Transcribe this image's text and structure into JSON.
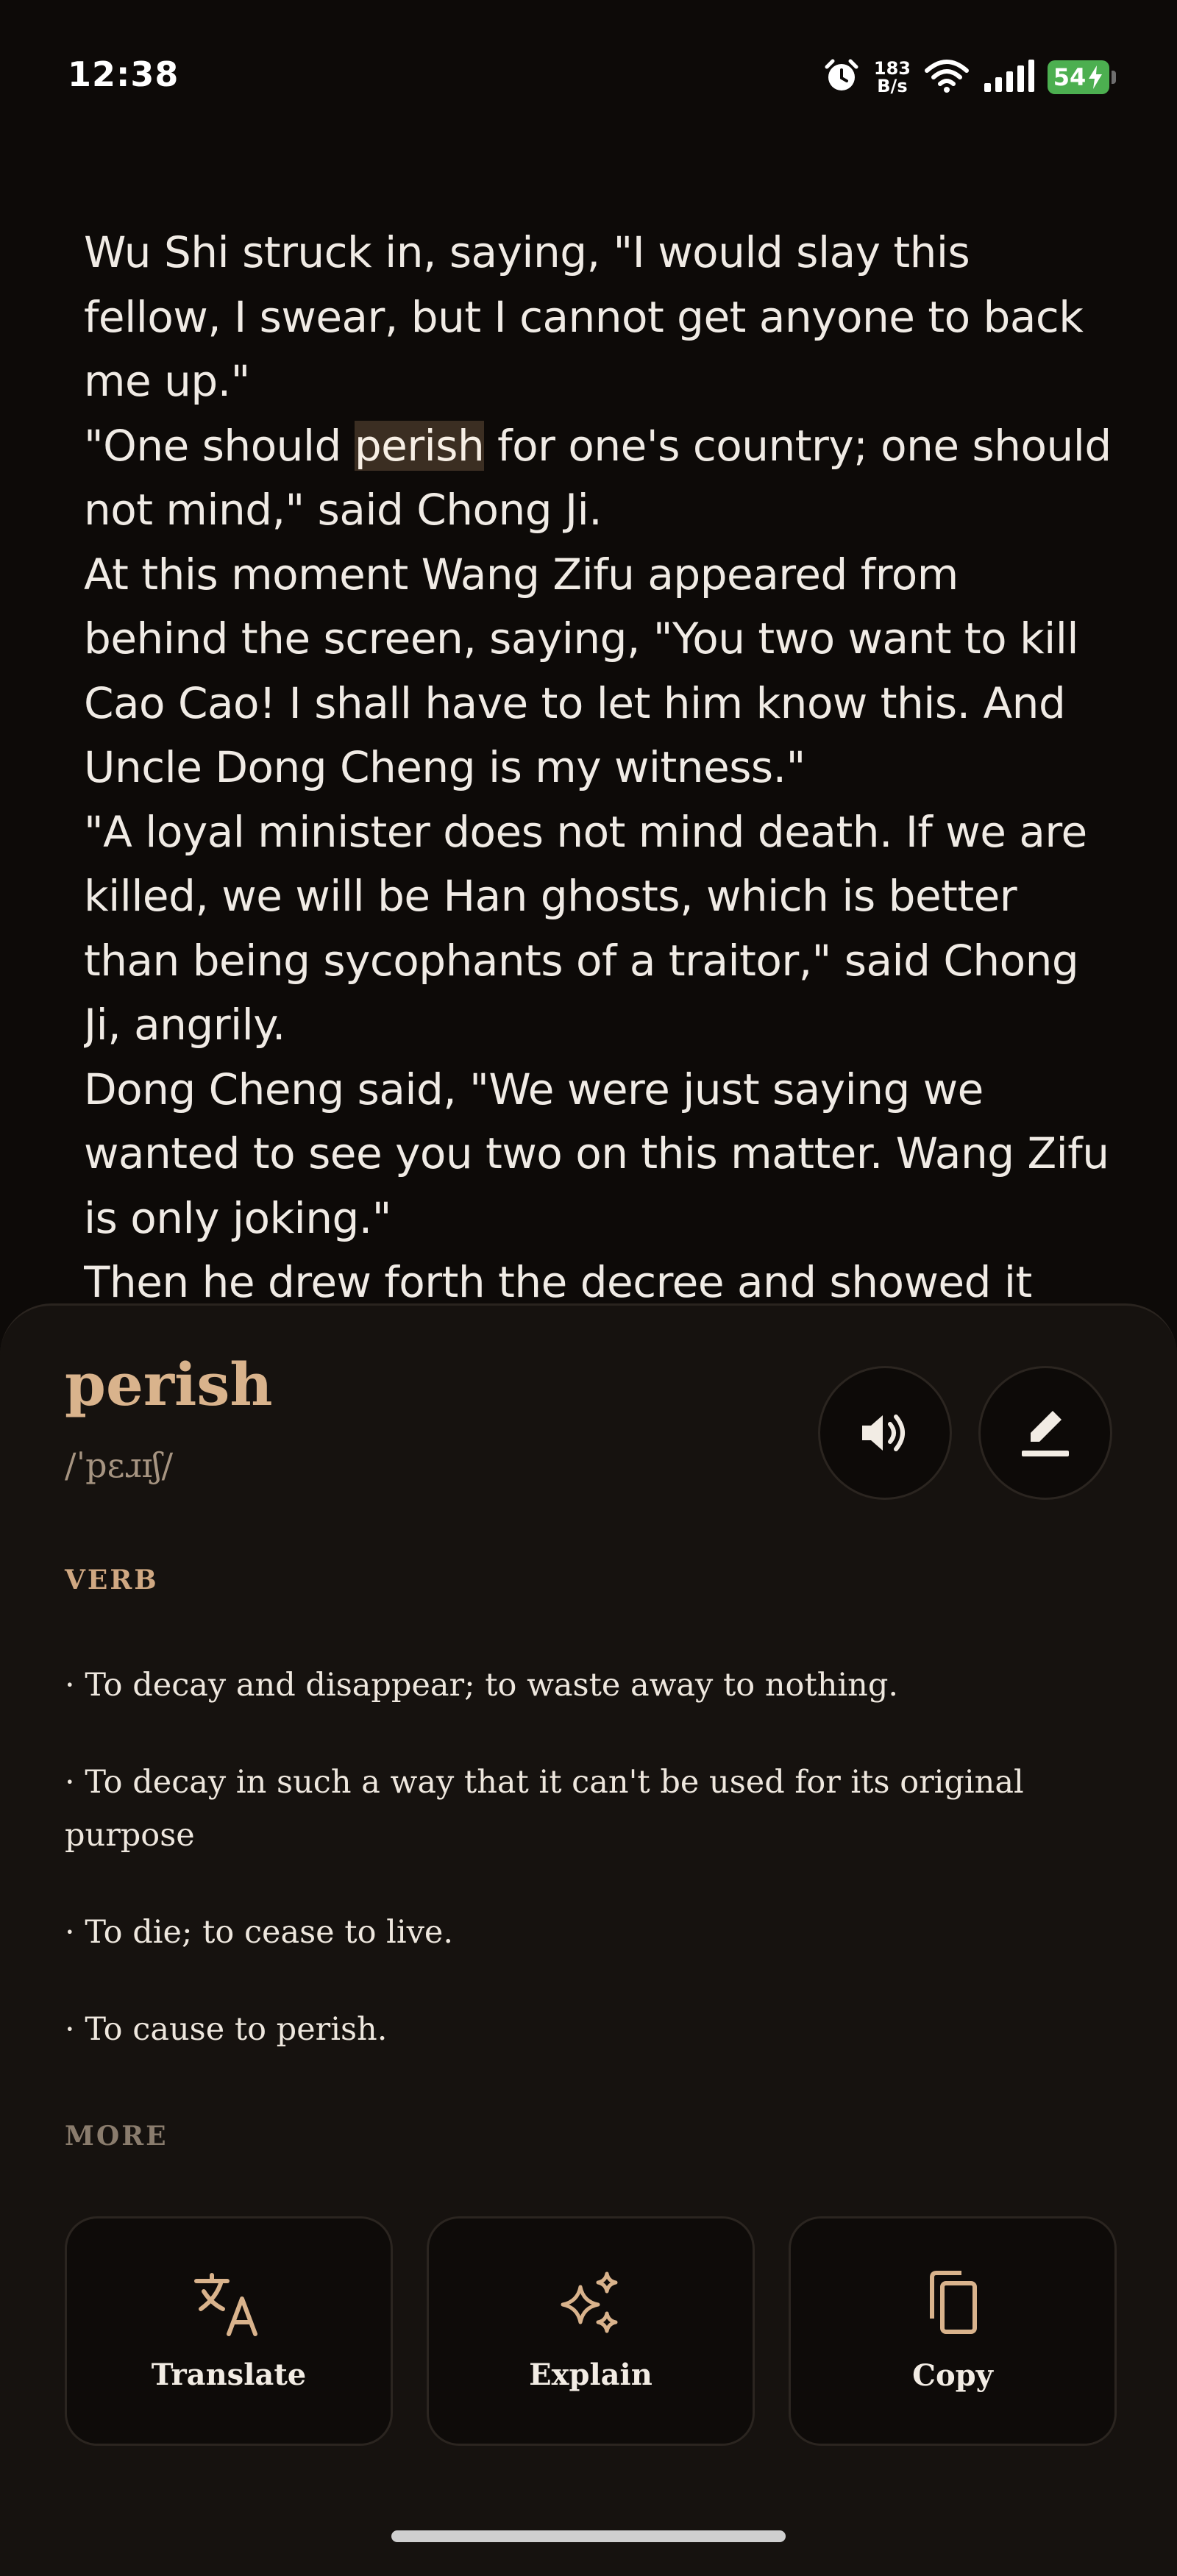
{
  "status_bar": {
    "time": "12:38",
    "net_speed_value": "183",
    "net_speed_unit": "B/s",
    "battery": "54",
    "icons": [
      "alarm-icon",
      "wifi-icon",
      "signal-icon",
      "battery-icon",
      "charging-icon"
    ]
  },
  "reader": {
    "paragraphs": [
      "Wu Shi struck in, saying, \"I would slay this fellow, I swear, but I cannot get anyone to back me up.\"",
      "\"One should ",
      "At this moment Wang Zifu appeared from behind the screen, saying, \"You two want to kill Cao Cao! I shall have to let him know this. And Uncle Dong Cheng is my witness.\"",
      "\"A loyal minister does not mind death. If we are killed, we will be Han ghosts, which is better than being sycophants of a traitor,\" said Chong Ji, angrily.",
      "Dong Cheng said, \"We were just saying we wanted to see you two on this matter. Wang Zifu is only joking.\"",
      "Then he drew forth the decree and showed it"
    ],
    "highlighted_word": "perish",
    "paragraph2_rest": " for one's country; one should not mind,\" said Chong Ji."
  },
  "dictionary": {
    "word": "perish",
    "pronunciation": "/ˈpɛɹɪʃ/",
    "part_of_speech": "VERB",
    "definitions": [
      "·  To decay and disappear; to waste away to nothing.",
      "·  To decay in such a way that it can't be used for its original purpose",
      "·  To die; to cease to live.",
      "·  To cause to perish."
    ],
    "more_label": "MORE",
    "actions": [
      {
        "label": "Translate",
        "icon": "translate-icon"
      },
      {
        "label": "Explain",
        "icon": "sparkle-icon"
      },
      {
        "label": "Copy",
        "icon": "copy-icon"
      }
    ],
    "speaker_icon": "speaker-icon",
    "edit_icon": "edit-icon"
  },
  "colors": {
    "background": "#0d0a08",
    "sheet": "#16120f",
    "accent": "#d9b38c",
    "highlight": "#3b2e22",
    "battery": "#4caf50"
  }
}
